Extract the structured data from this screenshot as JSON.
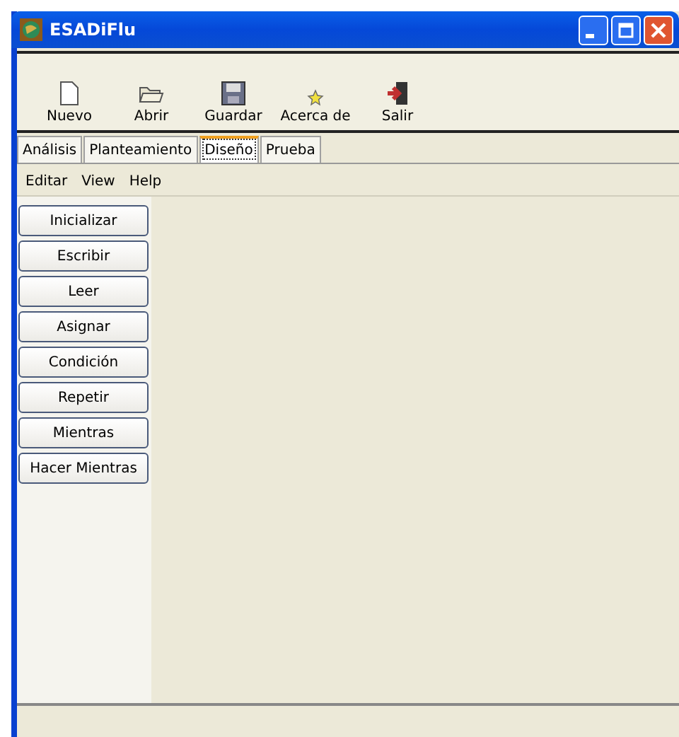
{
  "window": {
    "title": "ESADiFlu"
  },
  "toolbar": [
    {
      "label": "Nuevo",
      "kind": "new"
    },
    {
      "label": "Abrir",
      "kind": "open"
    },
    {
      "label": "Guardar",
      "kind": "save"
    },
    {
      "label": "Acerca de",
      "kind": "about"
    },
    {
      "label": "Salir",
      "kind": "exit"
    }
  ],
  "tabs": [
    {
      "label": "Análisis",
      "selected": false
    },
    {
      "label": "Planteamiento",
      "selected": false
    },
    {
      "label": "Diseño",
      "selected": true
    },
    {
      "label": "Prueba",
      "selected": false
    }
  ],
  "menu": [
    "Editar",
    "View",
    "Help"
  ],
  "palette": [
    "Inicializar",
    "Escribir",
    "Leer",
    "Asignar",
    "Condición",
    "Repetir",
    "Mientras",
    "Hacer Mientras"
  ]
}
